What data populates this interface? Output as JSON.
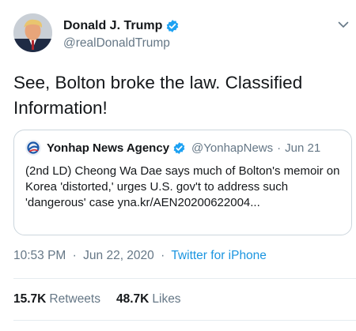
{
  "author": {
    "name": "Donald J. Trump",
    "handle": "@realDonaldTrump",
    "verified_color": "#1da1f2"
  },
  "tweet": {
    "text": "See, Bolton broke the law. Classified Information!"
  },
  "quoted_tweet": {
    "name": "Yonhap News Agency",
    "handle": "@YonhapNews",
    "separator": "·",
    "date": "Jun 21",
    "text": "(2nd LD) Cheong Wa Dae says much of Bolton's memoir on Korea 'distorted,' urges U.S. gov't to address such 'dangerous' case yna.kr/AEN20200622004..."
  },
  "meta": {
    "time": "10:53 PM",
    "separator": "·",
    "date": "Jun 22, 2020",
    "source": "Twitter for iPhone",
    "link_color": "#1b95e0"
  },
  "stats": {
    "retweets_count": "15.7K",
    "retweets_label": "Retweets",
    "likes_count": "48.7K",
    "likes_label": "Likes"
  },
  "icons": {
    "avatar": "profile-photo",
    "verified": "verified-badge-icon",
    "caret": "chevron-down-icon",
    "quoted_avatar": "yonhap-logo"
  }
}
